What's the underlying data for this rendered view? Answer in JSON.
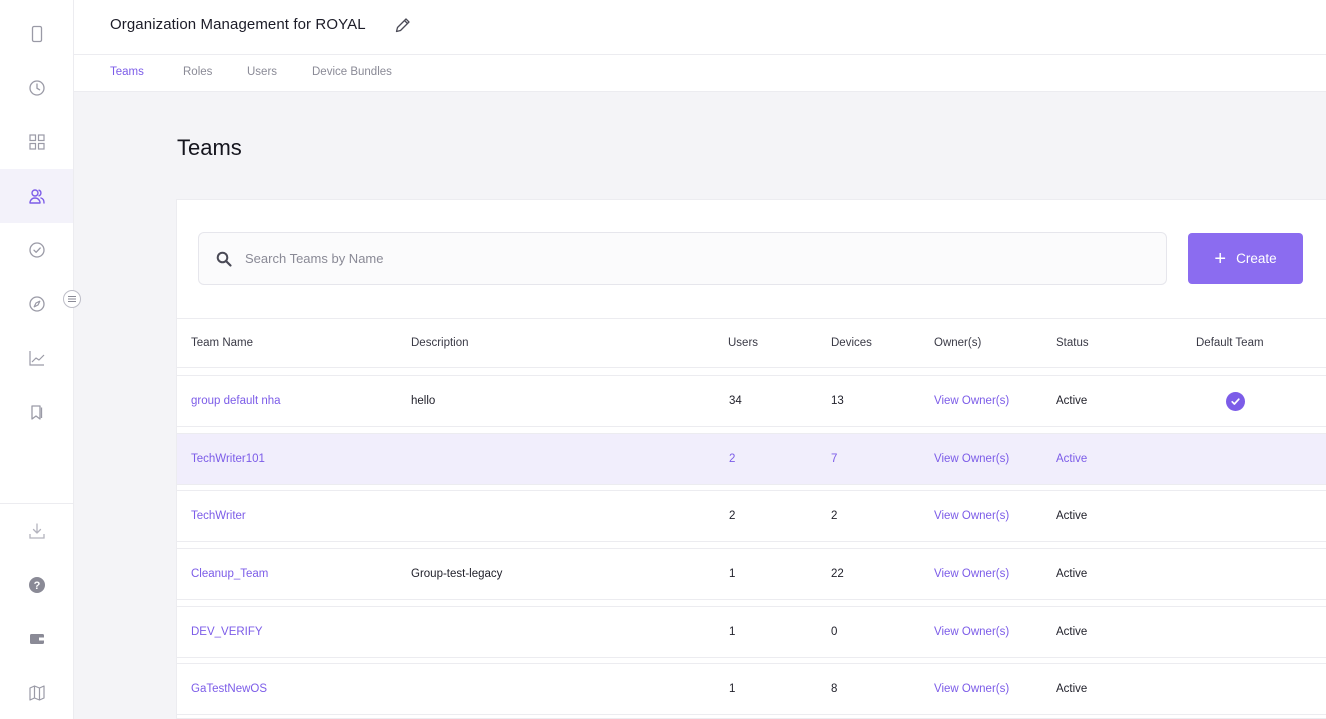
{
  "header": {
    "title": "Organization Management for ROYAL"
  },
  "tabs": [
    {
      "label": "Teams",
      "active": true
    },
    {
      "label": "Roles"
    },
    {
      "label": "Users"
    },
    {
      "label": "Device Bundles"
    }
  ],
  "sidebar": {
    "items": [
      {
        "icon": "device-icon"
      },
      {
        "icon": "clock-icon"
      },
      {
        "icon": "dashboard-grid-icon"
      },
      {
        "icon": "users-icon",
        "active": true
      },
      {
        "icon": "check-circle-icon"
      },
      {
        "icon": "compass-icon"
      },
      {
        "icon": "chart-line-icon"
      },
      {
        "icon": "bookmark-icon"
      }
    ],
    "bottom_items": [
      {
        "icon": "download-icon"
      },
      {
        "icon": "help-icon"
      },
      {
        "icon": "wallet-icon"
      },
      {
        "icon": "map-icon"
      }
    ],
    "collapse_icon": "menu-lines-icon"
  },
  "main": {
    "title": "Teams",
    "search": {
      "placeholder": "Search Teams by Name"
    },
    "create_label": "Create"
  },
  "table": {
    "columns": [
      "Team Name",
      "Description",
      "Users",
      "Devices",
      "Owner(s)",
      "Status",
      "Default Team"
    ],
    "rows": [
      {
        "name": "group default nha",
        "description": "hello",
        "users": "34",
        "devices": "13",
        "owners": "View Owner(s)",
        "status": "Active",
        "default": true
      },
      {
        "name": "TechWriter101",
        "description": "",
        "users": "2",
        "devices": "7",
        "owners": "View Owner(s)",
        "status": "Active",
        "default": false,
        "highlighted": true
      },
      {
        "name": "TechWriter",
        "description": "",
        "users": "2",
        "devices": "2",
        "owners": "View Owner(s)",
        "status": "Active",
        "default": false
      },
      {
        "name": "Cleanup_Team",
        "description": "Group-test-legacy",
        "users": "1",
        "devices": "22",
        "owners": "View Owner(s)",
        "status": "Active",
        "default": false
      },
      {
        "name": "DEV_VERIFY",
        "description": "",
        "users": "1",
        "devices": "0",
        "owners": "View Owner(s)",
        "status": "Active",
        "default": false
      },
      {
        "name": "GaTestNewOS",
        "description": "",
        "users": "1",
        "devices": "8",
        "owners": "View Owner(s)",
        "status": "Active",
        "default": false
      }
    ]
  },
  "colors": {
    "accent": "#7c5ce8",
    "button": "#8b6cf0",
    "highlight_row": "#f1eefc"
  }
}
